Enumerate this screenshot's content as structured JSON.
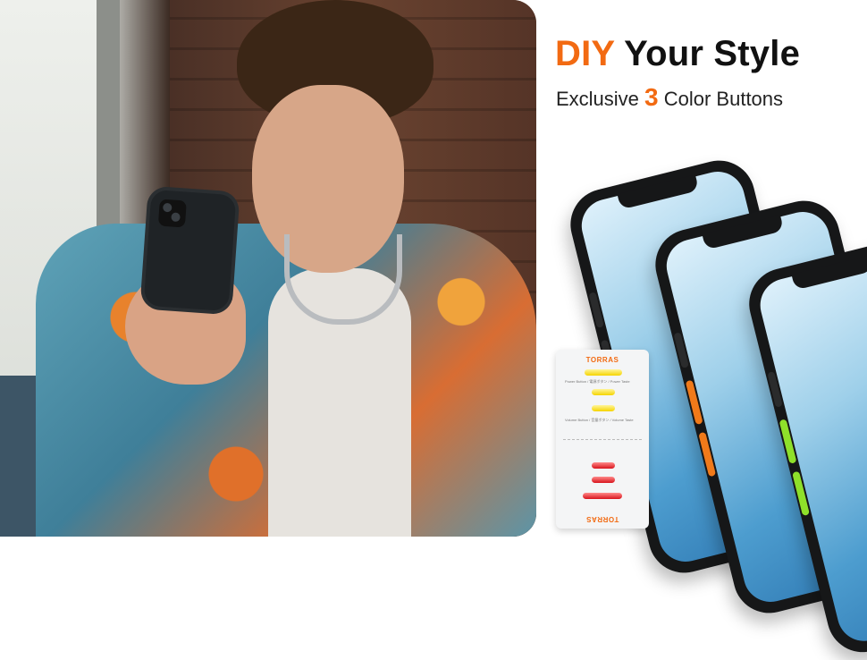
{
  "headline": {
    "accent": "DIY",
    "rest": " Your Style"
  },
  "subline": {
    "before": "Exclusive ",
    "number": "3",
    "after": " Color Buttons"
  },
  "card": {
    "brand": "TORRAS",
    "power_label": "Power Button / 電源ボタン / Power Taste",
    "volume_label": "Volume Button / 音量ボタン / Volume Taste"
  },
  "colors": {
    "accent": "#f26a12",
    "case": "#161718",
    "button_orange": "#f07a1a",
    "button_green": "#8fe02a",
    "button_yellow": "#f5d400",
    "button_red": "#d8141c"
  }
}
